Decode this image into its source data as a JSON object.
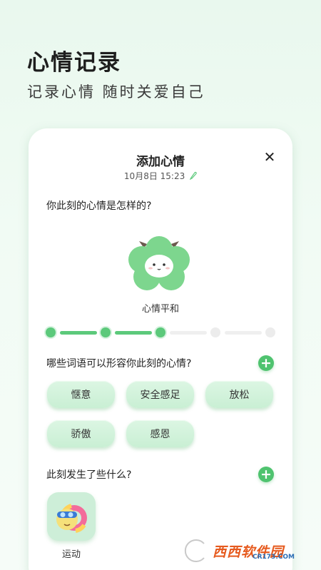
{
  "header": {
    "title": "心情记录",
    "subtitle": "记录心情 随时关爱自己"
  },
  "card": {
    "title": "添加心情",
    "datetime": "10月8日 15:23",
    "question_mood": "你此刻的心情是怎样的?",
    "mood_label": "心情平和",
    "mood_level": {
      "value": 3,
      "max": 5
    },
    "question_words": "哪些词语可以形容你此刻的心情?",
    "word_tags": [
      "惬意",
      "安全感足",
      "放松",
      "骄傲",
      "感恩"
    ],
    "question_events": "此刻发生了些什么?",
    "activities": [
      {
        "label": "运动",
        "icon": "swimming-icon"
      }
    ]
  },
  "watermark": {
    "text": "西西软件园",
    "sub": "CR173.COM"
  },
  "colors": {
    "accent": "#4fc36f",
    "chip": "#d3f3dc",
    "background": "#eef9f1"
  }
}
